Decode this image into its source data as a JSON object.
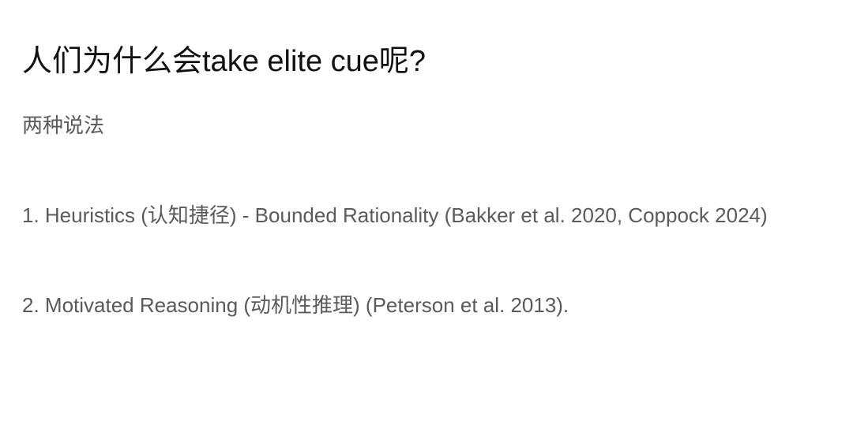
{
  "slide": {
    "title": "人们为什么会take elite cue呢?",
    "subtitle": "两种说法",
    "items": [
      "1. Heuristics (认知捷径) - Bounded Rationality (Bakker et al. 2020, Coppock 2024)",
      "2. Motivated Reasoning (动机性推理) (Peterson et al. 2013)."
    ]
  },
  "colors": {
    "title": "#111111",
    "body": "#5a5a5a",
    "background": "#ffffff"
  }
}
